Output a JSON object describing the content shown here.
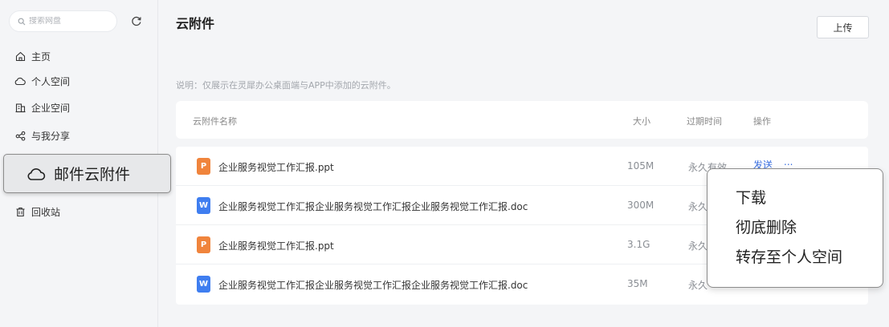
{
  "sidebar": {
    "search_placeholder": "搜索网盘",
    "nav": [
      {
        "label": "主页",
        "icon": "home-icon"
      },
      {
        "label": "个人空间",
        "icon": "cloud-icon"
      },
      {
        "label": "企业空间",
        "icon": "building-icon"
      },
      {
        "label": "与我分享",
        "icon": "share-icon"
      }
    ],
    "active_item": {
      "label": "邮件云附件",
      "icon": "cloud-icon"
    },
    "recycle": {
      "label": "回收站",
      "icon": "trash-icon"
    }
  },
  "main": {
    "title": "云附件",
    "upload_label": "上传",
    "notice": "说明：仅展示在灵犀办公桌面端与APP中添加的云附件。",
    "columns": {
      "name": "云附件名称",
      "size": "大小",
      "expire": "过期时间",
      "actions": "操作"
    },
    "files": [
      {
        "type": "ppt",
        "badge": "P",
        "name": "企业服务视觉工作汇报.ppt",
        "size": "105M",
        "expire": "永久有效",
        "send": "发送",
        "more": "..."
      },
      {
        "type": "doc",
        "badge": "W",
        "name": "企业服务视觉工作汇报企业服务视觉工作汇报企业服务视觉工作汇报.doc",
        "size": "300M",
        "expire": "永久",
        "send": "",
        "more": ""
      },
      {
        "type": "ppt",
        "badge": "P",
        "name": "企业服务视觉工作汇报.ppt",
        "size": "3.1G",
        "expire": "永久",
        "send": "",
        "more": ""
      },
      {
        "type": "doc",
        "badge": "W",
        "name": "企业服务视觉工作汇报企业服务视觉工作汇报企业服务视觉工作汇报.doc",
        "size": "35M",
        "expire": "永久",
        "send": "",
        "more": ""
      }
    ]
  },
  "context_menu": {
    "items": [
      "下载",
      "彻底删除",
      "转存至个人空间"
    ]
  },
  "colors": {
    "accent": "#3a6fe0",
    "ppt": "#f0843c",
    "doc": "#3f7ef0"
  }
}
